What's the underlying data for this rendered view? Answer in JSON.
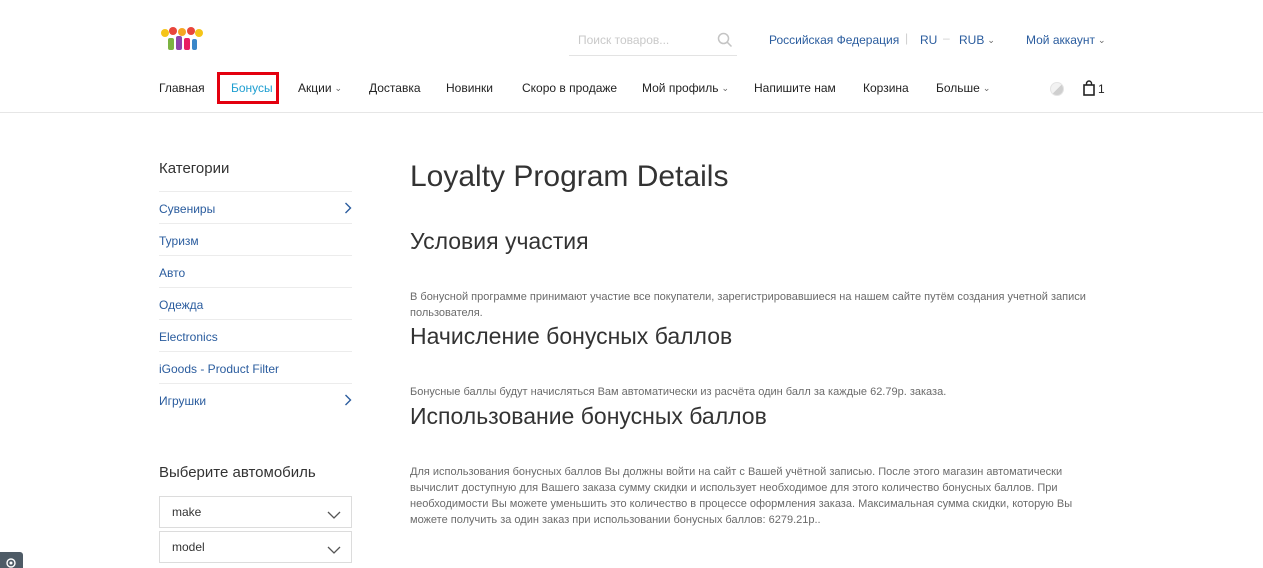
{
  "header": {
    "search_placeholder": "Поиск товаров...",
    "region": "Российская Федерация",
    "language": "RU",
    "lang_sep": "–",
    "currency": "RUB",
    "divider": "|",
    "account": "Мой аккаунт",
    "cart_count": "1"
  },
  "nav": {
    "items": [
      {
        "label": "Главная"
      },
      {
        "label": "Бонусы"
      },
      {
        "label": "Акции"
      },
      {
        "label": "Доставка"
      },
      {
        "label": "Новинки"
      },
      {
        "label": "Скоро в продаже"
      },
      {
        "label": "Мой профиль"
      },
      {
        "label": "Напишите нам"
      },
      {
        "label": "Корзина"
      },
      {
        "label": "Больше"
      }
    ],
    "active_index": 1
  },
  "sidebar": {
    "categories_title": "Категории",
    "categories": [
      {
        "label": "Сувениры",
        "has_children": true
      },
      {
        "label": "Туризм",
        "has_children": false
      },
      {
        "label": "Авто",
        "has_children": false
      },
      {
        "label": "Одежда",
        "has_children": false
      },
      {
        "label": "Electronics",
        "has_children": false
      },
      {
        "label": "iGoods - Product Filter",
        "has_children": false
      },
      {
        "label": "Игрушки",
        "has_children": true
      }
    ],
    "car_title": "Выберите автомобиль",
    "make_value": "make",
    "model_value": "model"
  },
  "main": {
    "title": "Loyalty Program Details",
    "sections": [
      {
        "heading": "Условия участия",
        "text": "В бонусной программе принимают участие все покупатели, зарегистрировавшиеся на нашем сайте путём создания учетной записи пользователя."
      },
      {
        "heading": "Начисление бонусных баллов",
        "text": "Бонусные баллы будут начисляться Вам автоматически из расчёта один балл за каждые 62.79р. заказа."
      },
      {
        "heading": "Использование бонусных баллов",
        "text": "Для использования бонусных баллов Вы должны войти на сайт с Вашей учётной записью. После этого магазин автоматически вычислит доступную для Вашего заказа сумму скидки и использует необходимое для этого количество бонусных баллов. При необходимости Вы можете уменьшить это количество в процессе оформления заказа. Максимальная сумма скидки, которую Вы можете получить за один заказ при использовании бонусных баллов: 6279.21р.."
      }
    ]
  },
  "colors": {
    "link": "#2a5c9e",
    "active_nav": "#1f9fd1",
    "highlight_box": "#e3000f"
  }
}
